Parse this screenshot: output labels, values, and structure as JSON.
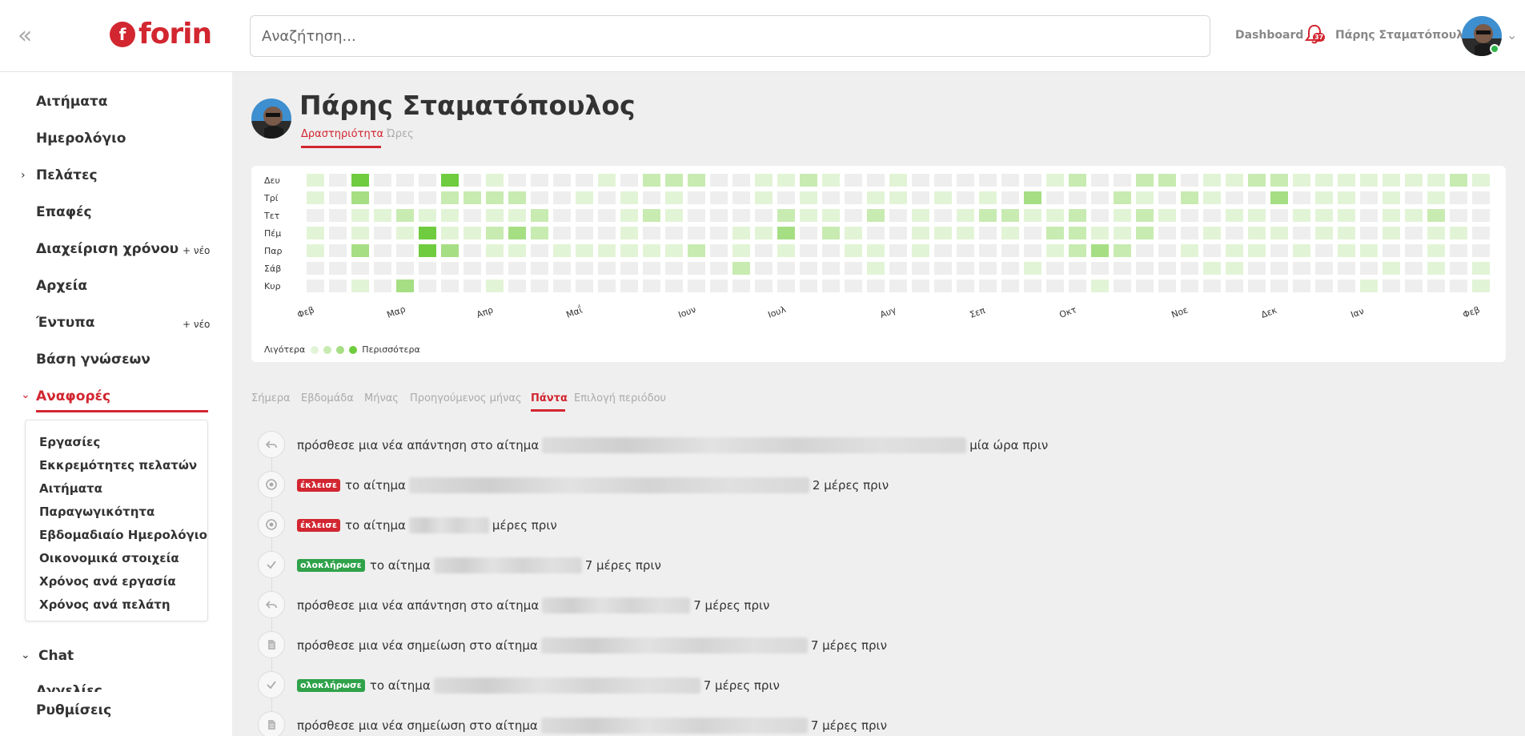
{
  "app": {
    "logo_text": "forin",
    "search_placeholder": "Αναζήτηση...",
    "dashboard_label": "Dashboard",
    "notification_count": "37",
    "user_name": "Πάρης Σταματόπουλος",
    "brand_color": "#d22630"
  },
  "sidebar": {
    "items": [
      {
        "label": "Αιτήματα"
      },
      {
        "label": "Ημερολόγιο"
      },
      {
        "label": "Πελάτες"
      },
      {
        "label": "Επαφές"
      },
      {
        "label": "Διαχείριση χρόνου",
        "new_label": "+ νέο"
      },
      {
        "label": "Αρχεία"
      },
      {
        "label": "Έντυπα",
        "new_label": "+ νέο"
      },
      {
        "label": "Βάση γνώσεων"
      },
      {
        "label": "Αναφορές"
      },
      {
        "label": "Chat"
      },
      {
        "label": "Αγγελίες"
      },
      {
        "label": "Ρυθμίσεις"
      }
    ],
    "reports_submenu": [
      "Εργασίες",
      "Εκκρεμότητες πελατών",
      "Αιτήματα",
      "Παραγωγικότητα",
      "Εβδομαδιαίο Ημερολόγιο",
      "Οικονομικά στοιχεία",
      "Χρόνος ανά εργασία",
      "Χρόνος ανά πελάτη"
    ]
  },
  "profile": {
    "name": "Πάρης Σταματόπουλος",
    "tabs": [
      "Δραστηριότητα",
      "Ώρες"
    ],
    "active_tab": "Δραστηριότητα"
  },
  "heatmap": {
    "day_labels": [
      "Δευ",
      "Τρί",
      "Τετ",
      "Πέμ",
      "Παρ",
      "Σάβ",
      "Κυρ"
    ],
    "month_labels": [
      {
        "label": "Φεβ",
        "week": 0
      },
      {
        "label": "Μαρ",
        "week": 4
      },
      {
        "label": "Απρ",
        "week": 8
      },
      {
        "label": "Μαΐ",
        "week": 12
      },
      {
        "label": "Ιουν",
        "week": 17
      },
      {
        "label": "Ιουλ",
        "week": 21
      },
      {
        "label": "Αυγ",
        "week": 26
      },
      {
        "label": "Σεπ",
        "week": 30
      },
      {
        "label": "Οκτ",
        "week": 34
      },
      {
        "label": "Νοε",
        "week": 39
      },
      {
        "label": "Δεκ",
        "week": 43
      },
      {
        "label": "Ιαν",
        "week": 47
      },
      {
        "label": "Φεβ",
        "week": 52
      }
    ],
    "colors": [
      "#eeeeee",
      "#e2f4d6",
      "#c8ebb1",
      "#a6de84",
      "#6fcc3f"
    ],
    "legend_less": "Λιγότερα",
    "legend_more": "Περισσότερα",
    "weeks": [
      [
        1,
        1,
        0,
        1,
        1,
        0,
        0
      ],
      [
        0,
        0,
        0,
        0,
        0,
        0,
        0
      ],
      [
        4,
        3,
        1,
        1,
        3,
        0,
        1
      ],
      [
        0,
        0,
        1,
        0,
        0,
        0,
        0
      ],
      [
        0,
        0,
        2,
        1,
        0,
        0,
        3
      ],
      [
        0,
        0,
        1,
        4,
        4,
        0,
        0
      ],
      [
        4,
        2,
        1,
        1,
        3,
        0,
        0
      ],
      [
        0,
        2,
        0,
        1,
        0,
        0,
        0
      ],
      [
        1,
        2,
        1,
        2,
        1,
        0,
        1
      ],
      [
        0,
        2,
        1,
        3,
        1,
        0,
        0
      ],
      [
        0,
        0,
        2,
        2,
        0,
        0,
        0
      ],
      [
        0,
        0,
        0,
        0,
        1,
        0,
        0
      ],
      [
        0,
        1,
        0,
        0,
        1,
        0,
        0
      ],
      [
        1,
        0,
        0,
        0,
        1,
        0,
        0
      ],
      [
        0,
        1,
        1,
        1,
        1,
        0,
        0
      ],
      [
        2,
        0,
        2,
        0,
        1,
        0,
        0
      ],
      [
        2,
        1,
        1,
        0,
        1,
        0,
        0
      ],
      [
        2,
        0,
        0,
        0,
        2,
        0,
        0
      ],
      [
        0,
        0,
        0,
        0,
        0,
        0,
        0
      ],
      [
        0,
        0,
        0,
        1,
        1,
        2,
        0
      ],
      [
        1,
        1,
        0,
        1,
        0,
        0,
        0
      ],
      [
        1,
        0,
        2,
        3,
        1,
        0,
        0
      ],
      [
        2,
        1,
        1,
        0,
        0,
        0,
        0
      ],
      [
        1,
        0,
        1,
        2,
        0,
        0,
        0
      ],
      [
        0,
        0,
        0,
        1,
        1,
        0,
        0
      ],
      [
        0,
        1,
        2,
        0,
        1,
        1,
        0
      ],
      [
        1,
        1,
        0,
        0,
        0,
        0,
        0
      ],
      [
        0,
        0,
        1,
        1,
        1,
        0,
        0
      ],
      [
        0,
        1,
        0,
        1,
        0,
        0,
        0
      ],
      [
        0,
        0,
        1,
        1,
        0,
        0,
        0
      ],
      [
        0,
        1,
        2,
        0,
        0,
        0,
        0
      ],
      [
        0,
        0,
        2,
        1,
        0,
        0,
        0
      ],
      [
        0,
        3,
        1,
        0,
        0,
        1,
        0
      ],
      [
        1,
        0,
        1,
        2,
        1,
        0,
        0
      ],
      [
        2,
        0,
        2,
        2,
        2,
        0,
        0
      ],
      [
        0,
        0,
        0,
        1,
        3,
        0,
        1
      ],
      [
        0,
        2,
        1,
        1,
        2,
        0,
        0
      ],
      [
        2,
        1,
        2,
        2,
        0,
        0,
        0
      ],
      [
        2,
        0,
        1,
        0,
        0,
        0,
        0
      ],
      [
        0,
        2,
        0,
        0,
        1,
        0,
        0
      ],
      [
        1,
        1,
        0,
        1,
        0,
        1,
        0
      ],
      [
        1,
        0,
        1,
        0,
        1,
        1,
        0
      ],
      [
        2,
        0,
        1,
        1,
        1,
        0,
        0
      ],
      [
        2,
        3,
        0,
        1,
        0,
        0,
        0
      ],
      [
        1,
        0,
        1,
        0,
        1,
        0,
        0
      ],
      [
        1,
        1,
        1,
        1,
        0,
        0,
        0
      ],
      [
        1,
        1,
        1,
        1,
        1,
        0,
        0
      ],
      [
        1,
        0,
        0,
        0,
        1,
        0,
        1
      ],
      [
        1,
        1,
        1,
        1,
        0,
        1,
        0
      ],
      [
        1,
        0,
        1,
        0,
        0,
        0,
        0
      ],
      [
        1,
        1,
        2,
        1,
        1,
        1,
        0
      ],
      [
        2,
        0,
        0,
        1,
        0,
        0,
        0
      ],
      [
        1,
        0,
        0,
        0,
        0,
        1,
        1
      ]
    ]
  },
  "filter_tabs": {
    "items": [
      "Σήμερα",
      "Εβδομάδα",
      "Μήνας",
      "Προηγούμενος μήνας",
      "Πάντα",
      "Επιλογή περιόδου"
    ],
    "active": "Πάντα"
  },
  "activity": [
    {
      "icon": "reply-icon",
      "prefix": "",
      "text": "πρόσθεσε μια νέα απάντηση στο αίτημα",
      "blur_width": 530,
      "time": "μία ώρα πριν"
    },
    {
      "icon": "closed-icon",
      "prefix": "έκλεισε",
      "prefix_color": "red",
      "text": "το αίτημα",
      "blur_width": 500,
      "time": "2 μέρες πριν"
    },
    {
      "icon": "closed-icon",
      "prefix": "έκλεισε",
      "prefix_color": "red",
      "text": "το αίτημα",
      "blur_width": 100,
      "time": "μέρες πριν"
    },
    {
      "icon": "check-icon",
      "prefix": "ολοκλήρωσε",
      "prefix_color": "green",
      "text": "το αίτημα",
      "blur_width": 185,
      "time": "7 μέρες πριν"
    },
    {
      "icon": "reply-icon",
      "prefix": "",
      "text": "πρόσθεσε μια νέα απάντηση στο αίτημα",
      "blur_width": 185,
      "time": "7 μέρες πριν"
    },
    {
      "icon": "note-icon",
      "prefix": "",
      "text": "πρόσθεσε μια νέα σημείωση στο αίτημα",
      "blur_width": 333,
      "time": "7 μέρες πριν"
    },
    {
      "icon": "check-icon",
      "prefix": "ολοκλήρωσε",
      "prefix_color": "green",
      "text": "το αίτημα",
      "blur_width": 333,
      "time": "7 μέρες πριν"
    },
    {
      "icon": "note-icon",
      "prefix": "",
      "text": "πρόσθεσε μια νέα σημείωση στο αίτημα",
      "blur_width": 333,
      "time": "7 μέρες πριν"
    }
  ]
}
